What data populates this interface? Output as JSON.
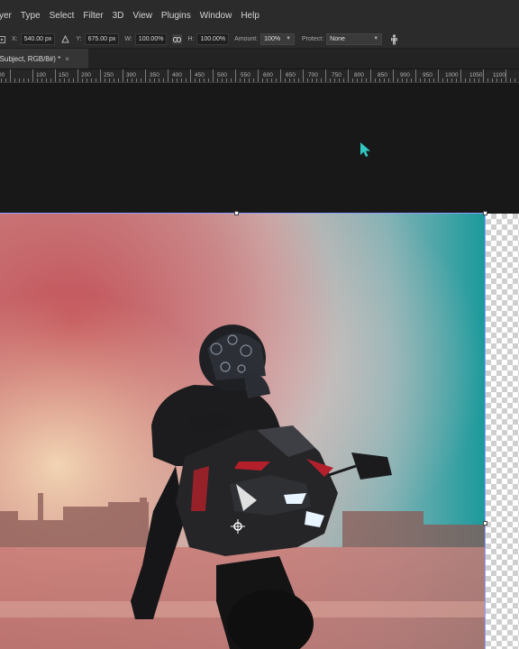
{
  "menubar": {
    "items": [
      "yer",
      "Type",
      "Select",
      "Filter",
      "3D",
      "View",
      "Plugins",
      "Window",
      "Help"
    ]
  },
  "options": {
    "x_label": "X:",
    "x_value": "540.00 px",
    "y_label": "Y:",
    "y_value": "675.00 px",
    "w_label": "W:",
    "w_value": "100.00%",
    "h_label": "H:",
    "h_value": "100.00%",
    "amount_label": "Amount:",
    "amount_value": "100%",
    "protect_label": "Protect:",
    "protect_value": "None",
    "icons": [
      "reference-point-icon",
      "delta-triangle-icon",
      "link-icon",
      "chevron-down-icon",
      "puppet-figure-icon"
    ]
  },
  "tab": {
    "title": "(Subject, RGB/8#) *",
    "close": "×"
  },
  "ruler": {
    "labels": [
      "00",
      "100",
      "150",
      "200",
      "250",
      "300",
      "350",
      "400",
      "450",
      "500",
      "550",
      "600",
      "650",
      "700",
      "750",
      "800",
      "850",
      "900",
      "950",
      "1000",
      "1050",
      "1100"
    ]
  },
  "colors": {
    "accent_cursor": "#2fc7c0",
    "bbox": "#8fa0ff",
    "sky_teal": "#1a9a9c",
    "smoke_red": "#c85a5f"
  }
}
